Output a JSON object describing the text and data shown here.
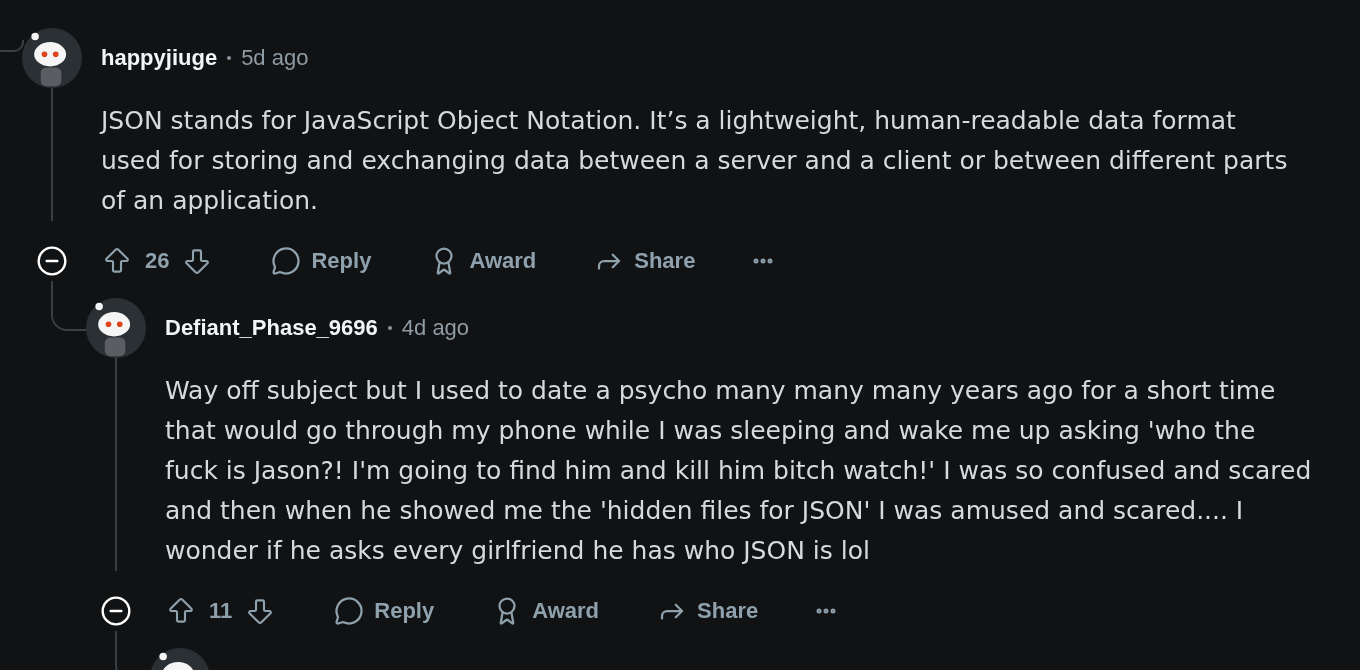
{
  "comments": [
    {
      "kind": "full",
      "author": "happyjiuge",
      "time": "5d ago",
      "expanded": true,
      "body": "JSON stands for JavaScript Object Notation. It’s a lightweight, human-readable data format used for storing and exchanging data between a server and a client or between different parts of an application.",
      "votes": "26",
      "actions": [
        "Reply",
        "Award",
        "Share"
      ],
      "children": [
        {
          "kind": "full",
          "author": "Defiant_Phase_9696",
          "time": "4d ago",
          "expanded": true,
          "body": "Way off subject but I used to date a psycho many many many years ago for a short time that would go through my phone while I was sleeping and wake me up asking 'who the fuck is Jason?! I'm going to find him and kill him bitch watch!' I was so confused and scared and then when he showed me the 'hidden files for JSON' I was amused and scared.... I wonder if he asks every girlfriend he has who JSON is lol",
          "votes": "11",
          "actions": [
            "Reply",
            "Award",
            "Share"
          ],
          "children": [
            {
              "kind": "partial"
            }
          ]
        }
      ]
    }
  ]
}
